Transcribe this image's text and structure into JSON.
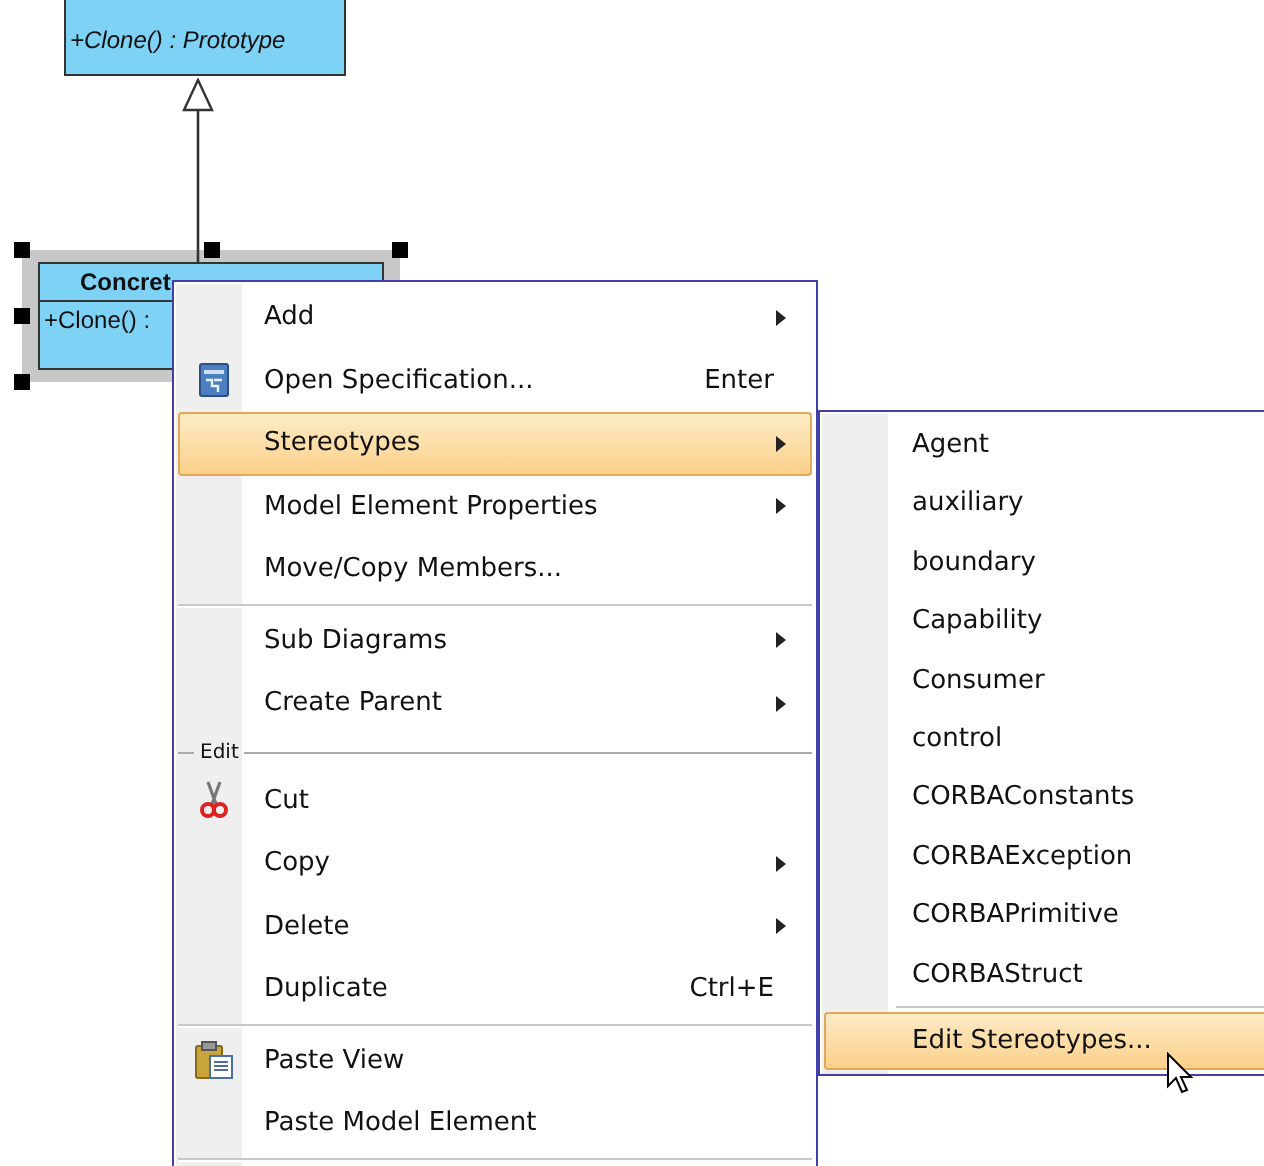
{
  "diagram": {
    "classes": [
      {
        "operation": "+Clone() : Prototype",
        "selected": false
      },
      {
        "name": "Concret",
        "operation": "+Clone() :",
        "selected": true
      }
    ]
  },
  "context_menu": {
    "items": [
      {
        "kind": "item",
        "label": "Add",
        "has_submenu": true,
        "selected": false
      },
      {
        "kind": "item",
        "label": "Open Specification...",
        "shortcut": "Enter",
        "has_submenu": false,
        "selected": false
      },
      {
        "kind": "item",
        "label": "Stereotypes",
        "has_submenu": true,
        "selected": true
      },
      {
        "kind": "item",
        "label": "Model Element Properties",
        "has_submenu": true,
        "selected": false
      },
      {
        "kind": "item",
        "label": "Move/Copy Members...",
        "has_submenu": false,
        "selected": false
      },
      {
        "kind": "separator"
      },
      {
        "kind": "item",
        "label": "Sub Diagrams",
        "has_submenu": true,
        "selected": false
      },
      {
        "kind": "item",
        "label": "Create Parent",
        "has_submenu": true,
        "selected": false
      },
      {
        "kind": "group",
        "label": "Edit"
      },
      {
        "kind": "item",
        "label": "Cut",
        "has_submenu": false,
        "selected": false
      },
      {
        "kind": "item",
        "label": "Copy",
        "has_submenu": true,
        "selected": false
      },
      {
        "kind": "item",
        "label": "Delete",
        "has_submenu": true,
        "selected": false
      },
      {
        "kind": "item",
        "label": "Duplicate",
        "shortcut": "Ctrl+E",
        "has_submenu": false,
        "selected": false
      },
      {
        "kind": "separator"
      },
      {
        "kind": "item",
        "label": "Paste View",
        "has_submenu": false,
        "selected": false
      },
      {
        "kind": "item",
        "label": "Paste Model Element",
        "has_submenu": false,
        "selected": false
      },
      {
        "kind": "separator"
      }
    ]
  },
  "submenu": {
    "items": [
      {
        "kind": "item",
        "label": "Agent",
        "selected": false
      },
      {
        "kind": "item",
        "label": "auxiliary",
        "selected": false
      },
      {
        "kind": "item",
        "label": "boundary",
        "selected": false
      },
      {
        "kind": "item",
        "label": "Capability",
        "selected": false
      },
      {
        "kind": "item",
        "label": "Consumer",
        "selected": false
      },
      {
        "kind": "item",
        "label": "control",
        "selected": false
      },
      {
        "kind": "item",
        "label": "CORBAConstants",
        "selected": false
      },
      {
        "kind": "item",
        "label": "CORBAException",
        "selected": false
      },
      {
        "kind": "item",
        "label": "CORBAPrimitive",
        "selected": false
      },
      {
        "kind": "item",
        "label": "CORBAStruct",
        "selected": false
      },
      {
        "kind": "separator"
      },
      {
        "kind": "item",
        "label": "Edit Stereotypes...",
        "selected": true
      }
    ]
  }
}
